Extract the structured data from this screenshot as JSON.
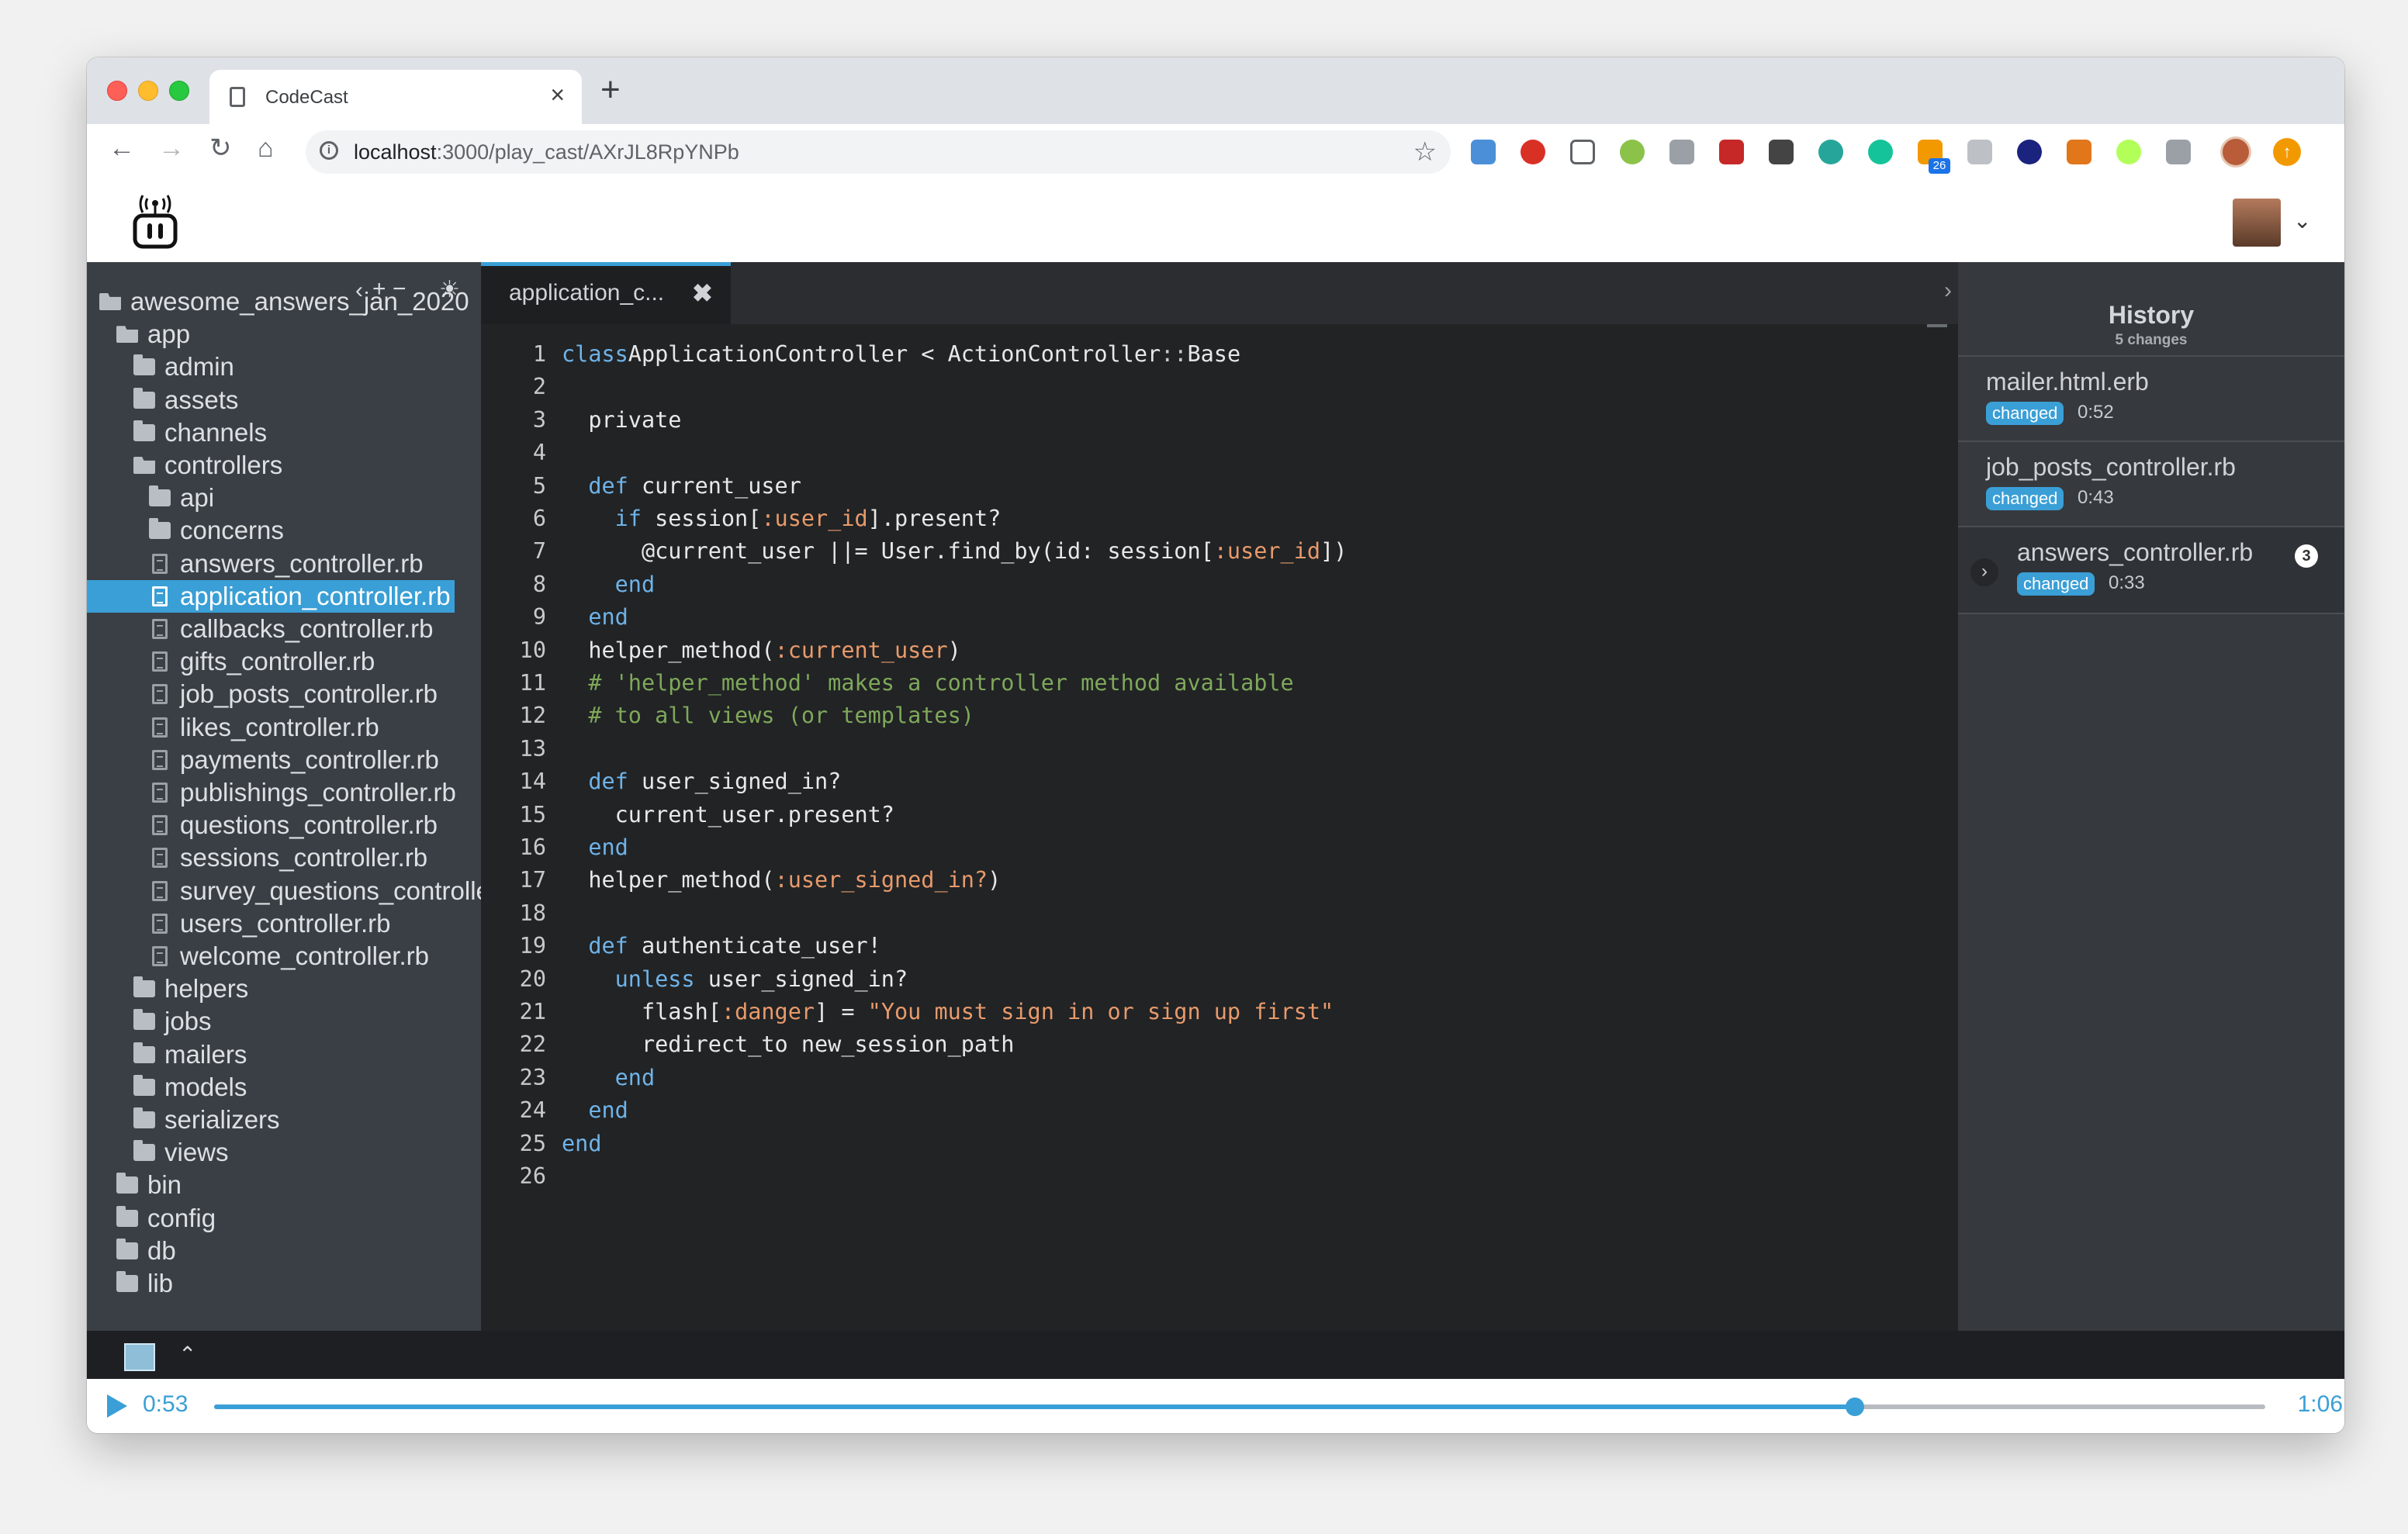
{
  "browser": {
    "tab_title": "CodeCast",
    "tab_close": "×",
    "new_tab": "+",
    "url_host": "localhost",
    "url_path": ":3000/play_cast/AXrJL8RpYNPb",
    "nav": {
      "back": "←",
      "forward": "→",
      "reload": "↻",
      "home": "⌂"
    },
    "star": "☆",
    "extensions_badge": "26"
  },
  "sidebar": {
    "tools": {
      "collapse": "‹",
      "add": "+",
      "remove": "−",
      "theme": "☀"
    },
    "tree": [
      {
        "label": "awesome_answers_jan_2020",
        "type": "folder-open",
        "depth": 0
      },
      {
        "label": "app",
        "type": "folder-open",
        "depth": 1
      },
      {
        "label": "admin",
        "type": "folder",
        "depth": 2
      },
      {
        "label": "assets",
        "type": "folder",
        "depth": 2
      },
      {
        "label": "channels",
        "type": "folder",
        "depth": 2
      },
      {
        "label": "controllers",
        "type": "folder-open",
        "depth": 2
      },
      {
        "label": "api",
        "type": "folder",
        "depth": 3
      },
      {
        "label": "concerns",
        "type": "folder",
        "depth": 3
      },
      {
        "label": "answers_controller.rb",
        "type": "file",
        "depth": 3
      },
      {
        "label": "application_controller.rb",
        "type": "file",
        "depth": 3,
        "selected": true
      },
      {
        "label": "callbacks_controller.rb",
        "type": "file",
        "depth": 3
      },
      {
        "label": "gifts_controller.rb",
        "type": "file",
        "depth": 3
      },
      {
        "label": "job_posts_controller.rb",
        "type": "file",
        "depth": 3
      },
      {
        "label": "likes_controller.rb",
        "type": "file",
        "depth": 3
      },
      {
        "label": "payments_controller.rb",
        "type": "file",
        "depth": 3
      },
      {
        "label": "publishings_controller.rb",
        "type": "file",
        "depth": 3
      },
      {
        "label": "questions_controller.rb",
        "type": "file",
        "depth": 3
      },
      {
        "label": "sessions_controller.rb",
        "type": "file",
        "depth": 3
      },
      {
        "label": "survey_questions_controller.rb",
        "type": "file",
        "depth": 3
      },
      {
        "label": "users_controller.rb",
        "type": "file",
        "depth": 3
      },
      {
        "label": "welcome_controller.rb",
        "type": "file",
        "depth": 3
      },
      {
        "label": "helpers",
        "type": "folder",
        "depth": 2
      },
      {
        "label": "jobs",
        "type": "folder",
        "depth": 2
      },
      {
        "label": "mailers",
        "type": "folder",
        "depth": 2
      },
      {
        "label": "models",
        "type": "folder",
        "depth": 2
      },
      {
        "label": "serializers",
        "type": "folder",
        "depth": 2
      },
      {
        "label": "views",
        "type": "folder",
        "depth": 2
      },
      {
        "label": "bin",
        "type": "folder",
        "depth": 1
      },
      {
        "label": "config",
        "type": "folder",
        "depth": 1
      },
      {
        "label": "db",
        "type": "folder",
        "depth": 1
      },
      {
        "label": "lib",
        "type": "folder",
        "depth": 1
      }
    ]
  },
  "editor": {
    "tab_label": "application_c...",
    "tab_close": "✖",
    "collapse_icon": "›",
    "lines": [
      [
        [
          "kw",
          "class"
        ],
        [
          "",
          "ApplicationController < ActionController"
        ],
        [
          "op",
          "::"
        ],
        [
          "",
          "Base"
        ]
      ],
      [],
      [
        [
          "",
          "  private"
        ]
      ],
      [],
      [
        [
          "kw",
          "  def"
        ],
        [
          "",
          " current_user"
        ]
      ],
      [
        [
          "kw",
          "    if"
        ],
        [
          "",
          " session["
        ],
        [
          "sym",
          ":user_id"
        ],
        [
          "",
          "].present?"
        ]
      ],
      [
        [
          "",
          "      @current_user ||= User.find_by(id: session["
        ],
        [
          "sym",
          ":user_id"
        ],
        [
          "",
          "])"
        ]
      ],
      [
        [
          "kw",
          "    end"
        ]
      ],
      [
        [
          "kw",
          "  end"
        ]
      ],
      [
        [
          "",
          "  helper_method("
        ],
        [
          "sym",
          ":current_user"
        ],
        [
          "",
          ")"
        ]
      ],
      [
        [
          "cmt",
          "  # 'helper_method' makes a controller method available"
        ]
      ],
      [
        [
          "cmt",
          "  # to all views (or templates)"
        ]
      ],
      [],
      [
        [
          "kw",
          "  def"
        ],
        [
          "",
          " user_signed_in?"
        ]
      ],
      [
        [
          "",
          "    current_user.present?"
        ]
      ],
      [
        [
          "kw",
          "  end"
        ]
      ],
      [
        [
          "",
          "  helper_method("
        ],
        [
          "sym",
          ":user_signed_in?"
        ],
        [
          "",
          ")"
        ]
      ],
      [],
      [
        [
          "kw",
          "  def"
        ],
        [
          "",
          " authenticate_user!"
        ]
      ],
      [
        [
          "kw",
          "    unless"
        ],
        [
          "",
          " user_signed_in?"
        ]
      ],
      [
        [
          "",
          "      flash["
        ],
        [
          "sym",
          ":danger"
        ],
        [
          "",
          "] = "
        ],
        [
          "str",
          "\"You must sign in or sign up first\""
        ]
      ],
      [
        [
          "",
          "      redirect_to new_session_path"
        ]
      ],
      [
        [
          "kw",
          "    end"
        ]
      ],
      [
        [
          "kw",
          "  end"
        ]
      ],
      [
        [
          "kw",
          "end"
        ]
      ],
      []
    ]
  },
  "history": {
    "title": "History",
    "count": "5 changes",
    "items": [
      {
        "file": "mailer.html.erb",
        "badge": "changed",
        "time": "0:52"
      },
      {
        "file": "job_posts_controller.rb",
        "badge": "changed",
        "time": "0:43"
      },
      {
        "file": "answers_controller.rb",
        "badge": "changed",
        "time": "0:33",
        "count": "3",
        "expand": "›"
      }
    ]
  },
  "statusbar": {
    "caret": "⌃"
  },
  "player": {
    "current_time": "0:53",
    "total_time": "1:06",
    "progress": 0.8
  },
  "colors": {
    "accent": "#3a9fd6",
    "sidebar": "#3a3f45",
    "editor": "#212325"
  }
}
